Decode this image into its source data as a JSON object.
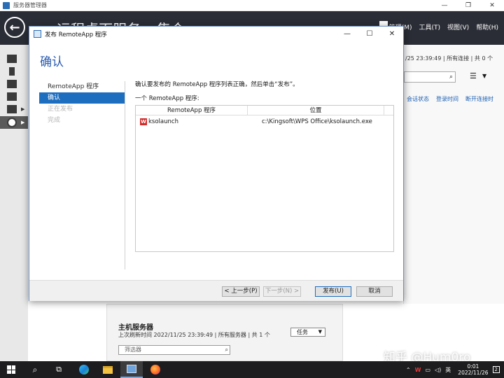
{
  "window": {
    "title": "服务器管理器",
    "breadcrumb": "··  远程桌面服务  ▸  集合  ▸  sever...",
    "menus": [
      "管理(M)",
      "工具(T)",
      "视图(V)",
      "帮助(H)"
    ]
  },
  "right_panel": {
    "info": "/25 23:39:49 | 所有连接 | 共 0 个",
    "columns": [
      "会话状态",
      "登录时间",
      "断开连接时"
    ]
  },
  "host": {
    "title": "主机服务器",
    "subtitle": "上次刷新时间 2022/11/25 23:39:49 | 所有服务器 | 共 1 个",
    "task_label": "任务",
    "filter_placeholder": "筛选器"
  },
  "dialog": {
    "title": "发布 RemoteApp 程序",
    "heading": "确认",
    "steps": [
      {
        "label": "RemoteApp 程序",
        "state": "done"
      },
      {
        "label": "确认",
        "state": "active"
      },
      {
        "label": "正在发布",
        "state": "disabled"
      },
      {
        "label": "完成",
        "state": "disabled"
      }
    ],
    "confirm_text": "确认要发布的 RemoteApp 程序列表正确，然后单击“发布”。",
    "count_text": "一个 RemoteApp 程序:",
    "table": {
      "headers": [
        "RemoteApp 程序",
        "位置"
      ],
      "rows": [
        {
          "name": "ksolaunch",
          "path": "c:\\Kingsoft\\WPS Office\\ksolaunch.exe"
        }
      ]
    },
    "buttons": {
      "prev": "< 上一步(P)",
      "next": "下一步(N) >",
      "publish": "发布(U)",
      "cancel": "取消"
    }
  },
  "taskbar": {
    "ime": "英",
    "time": "0:01",
    "date": "2022/11/26",
    "notifications": "2"
  },
  "watermark": "知乎 @Hum0ro"
}
